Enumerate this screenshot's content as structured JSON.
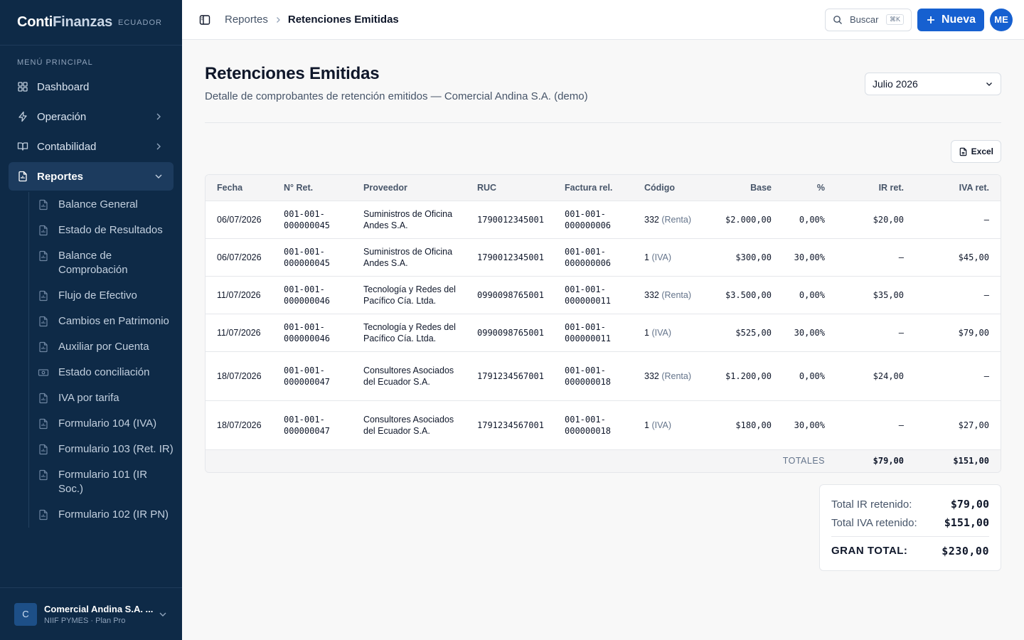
{
  "brand": {
    "name_a": "Conti",
    "name_b": "Finanzas",
    "country": "ECUADOR"
  },
  "sidebar": {
    "section_label": "MENÚ PRINCIPAL",
    "items": [
      {
        "label": "Dashboard",
        "icon": "dashboard-icon"
      },
      {
        "label": "Operación",
        "icon": "bolt-icon"
      },
      {
        "label": "Contabilidad",
        "icon": "book-icon"
      },
      {
        "label": "Reportes",
        "icon": "report-icon"
      }
    ],
    "report_items": [
      {
        "label": "Balance General"
      },
      {
        "label": "Estado de Resultados"
      },
      {
        "label": "Balance de Comprobación"
      },
      {
        "label": "Flujo de Efectivo"
      },
      {
        "label": "Cambios en Patrimonio"
      },
      {
        "label": "Auxiliar por Cuenta"
      },
      {
        "label": "Estado conciliación"
      },
      {
        "label": "IVA por tarifa"
      },
      {
        "label": "Formulario 104 (IVA)"
      },
      {
        "label": "Formulario 103 (Ret. IR)"
      },
      {
        "label": "Formulario 101 (IR Soc.)"
      },
      {
        "label": "Formulario 102 (IR PN)"
      }
    ],
    "company": {
      "initial": "C",
      "name": "Comercial Andina S.A. ...",
      "plan": "NIIF PYMES · Plan Pro"
    }
  },
  "header": {
    "breadcrumb_parent": "Reportes",
    "breadcrumb_current": "Retenciones Emitidas",
    "search_label": "Buscar",
    "search_shortcut": "⌘K",
    "new_label": "Nueva",
    "user_initials": "ME"
  },
  "page": {
    "title": "Retenciones Emitidas",
    "subtitle": "Detalle de comprobantes de retención emitidos — Comercial Andina S.A. (demo)",
    "period": "Julio 2026",
    "excel_label": "Excel"
  },
  "table": {
    "headers": [
      "Fecha",
      "N° Ret.",
      "Proveedor",
      "RUC",
      "Factura rel.",
      "Código",
      "Base",
      "%",
      "IR ret.",
      "IVA ret."
    ],
    "rows": [
      {
        "fecha": "06/07/2026",
        "ret": "001-001-000000045",
        "proveedor": "Suministros de Oficina Andes S.A.",
        "ruc": "1790012345001",
        "factura": "001-001-000000006",
        "codigo": "332",
        "tipo": "(Renta)",
        "base": "$2.000,00",
        "pct": "0,00%",
        "ir": "$20,00",
        "iva": "—"
      },
      {
        "fecha": "06/07/2026",
        "ret": "001-001-000000045",
        "proveedor": "Suministros de Oficina Andes S.A.",
        "ruc": "1790012345001",
        "factura": "001-001-000000006",
        "codigo": "1",
        "tipo": "(IVA)",
        "base": "$300,00",
        "pct": "30,00%",
        "ir": "—",
        "iva": "$45,00"
      },
      {
        "fecha": "11/07/2026",
        "ret": "001-001-000000046",
        "proveedor": "Tecnología y Redes del Pacífico Cía. Ltda.",
        "ruc": "0990098765001",
        "factura": "001-001-000000011",
        "codigo": "332",
        "tipo": "(Renta)",
        "base": "$3.500,00",
        "pct": "0,00%",
        "ir": "$35,00",
        "iva": "—"
      },
      {
        "fecha": "11/07/2026",
        "ret": "001-001-000000046",
        "proveedor": "Tecnología y Redes del Pacífico Cía. Ltda.",
        "ruc": "0990098765001",
        "factura": "001-001-000000011",
        "codigo": "1",
        "tipo": "(IVA)",
        "base": "$525,00",
        "pct": "30,00%",
        "ir": "—",
        "iva": "$79,00"
      },
      {
        "fecha": "18/07/2026",
        "ret": "001-001-000000047",
        "proveedor": "Consultores Asociados del Ecuador S.A.",
        "ruc": "1791234567001",
        "factura": "001-001-000000018",
        "codigo": "332",
        "tipo": "(Renta)",
        "base": "$1.200,00",
        "pct": "0,00%",
        "ir": "$24,00",
        "iva": "—"
      },
      {
        "fecha": "18/07/2026",
        "ret": "001-001-000000047",
        "proveedor": "Consultores Asociados del Ecuador S.A.",
        "ruc": "1791234567001",
        "factura": "001-001-000000018",
        "codigo": "1",
        "tipo": "(IVA)",
        "base": "$180,00",
        "pct": "30,00%",
        "ir": "—",
        "iva": "$27,00"
      }
    ],
    "totals_label": "TOTALES",
    "totals_ir": "$79,00",
    "totals_iva": "$151,00"
  },
  "summary": {
    "ir_label": "Total IR retenido:",
    "ir_value": "$79,00",
    "iva_label": "Total IVA retenido:",
    "iva_value": "$151,00",
    "grand_label": "GRAN TOTAL:",
    "grand_value": "$230,00"
  },
  "colors": {
    "sidebar_bg": "#0e2a47",
    "accent": "#1660d0"
  }
}
